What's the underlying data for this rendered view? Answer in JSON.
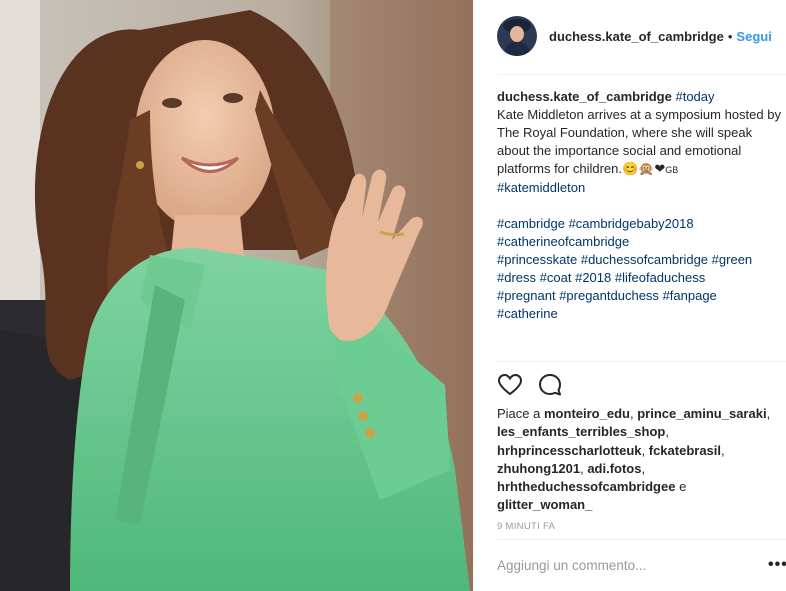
{
  "post": {
    "username": "duchess.kate_of_cambridge",
    "separator": "•",
    "follow_label": "Segui",
    "caption": {
      "username": "duchess.kate_of_cambridge",
      "first_tag": "#today",
      "text": "Kate Middleton arrives at a symposium hosted by The Royal Foundation, where she will speak about the importance social and emotional platforms for children.",
      "emoji": "😊🙊❤",
      "emoji_small": "GB",
      "tag_line": "#katemiddleton",
      "hashtags": [
        "#cambridge",
        "#cambridgebaby2018",
        "#catherineofcambridge",
        "#princesskate",
        "#duchessofcambridge",
        "#green",
        "#dress",
        "#coat",
        "#2018",
        "#lifeofaduchess",
        "#pregnant",
        "#pregantduchess",
        "#fanpage",
        "#catherine"
      ]
    },
    "likes": {
      "prefix": "Piace a",
      "users": [
        "monteiro_edu",
        "prince_aminu_saraki",
        "les_enfants_terribles_shop",
        "hrhprincesscharlotteuk",
        "fckatebrasil",
        "zhuhong1201",
        "adi.fotos",
        "hrhtheduchessofcambridgee",
        "glitter_woman_"
      ],
      "conjunction": "e"
    },
    "timestamp": "9 MINUTI FA",
    "comment_placeholder": "Aggiungi un commento...",
    "more_label": "•••"
  },
  "icons": {
    "like": "heart-icon",
    "comment": "comment-bubble-icon",
    "more": "more-options-icon"
  },
  "colors": {
    "accent": "#3897f0",
    "hashtag": "#003569",
    "text": "#262626",
    "muted": "#999999",
    "coat": "#5fbf84"
  }
}
